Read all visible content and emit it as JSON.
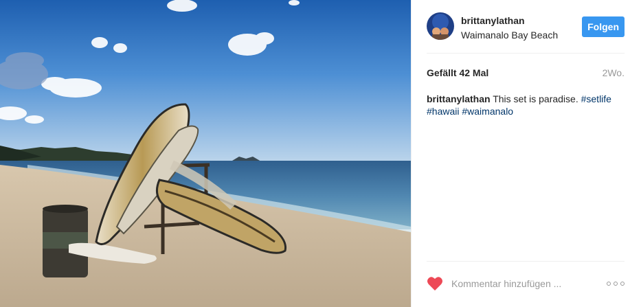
{
  "photo": {
    "alt": "Surfboards on Waimanalo Bay Beach"
  },
  "header": {
    "username": "brittanylathan",
    "location": "Waimanalo Bay Beach",
    "follow_label": "Folgen"
  },
  "stats": {
    "likes": "Gefällt 42 Mal",
    "time": "2Wo."
  },
  "caption": {
    "user": "brittanylathan",
    "text": "This set is paradise.",
    "tags": [
      "#setlife",
      "#hawaii",
      "#waimanalo"
    ]
  },
  "comment": {
    "placeholder": "Kommentar hinzufügen ..."
  },
  "colors": {
    "accent": "#3897f0",
    "heart": "#ed4956",
    "hashtag": "#003569"
  },
  "icons": [
    "heart-icon",
    "more-options-icon"
  ]
}
